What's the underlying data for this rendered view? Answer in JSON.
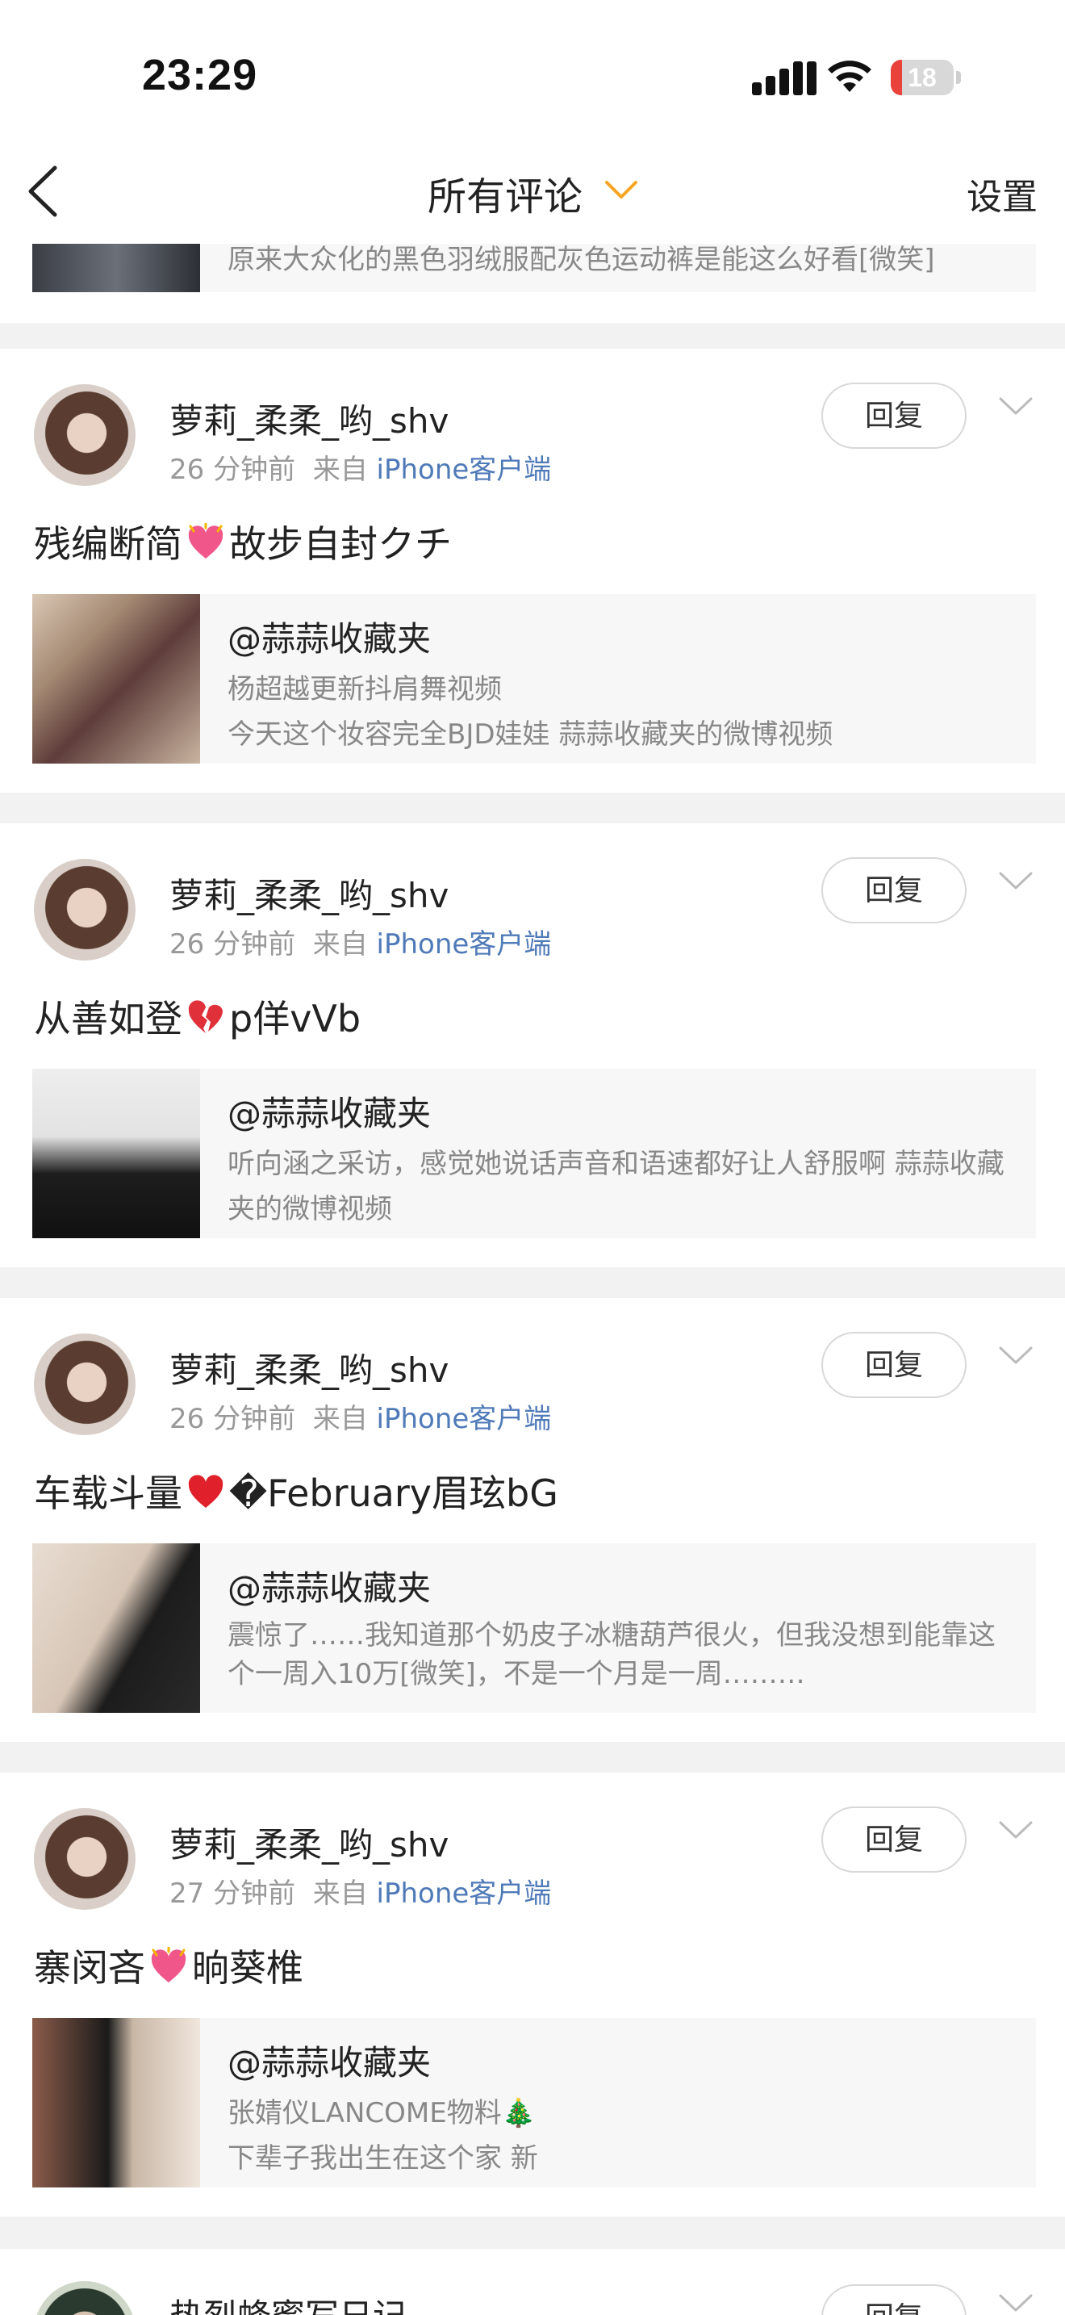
{
  "status": {
    "time": "23:29",
    "battery": "18",
    "battery_level": 0.18,
    "battery_color": "#e8423b"
  },
  "nav": {
    "title": "所有评论",
    "settings": "设置",
    "accent": "#f5a623"
  },
  "partial_top": {
    "text": "原来大众化的黑色羽绒服配灰色运动裤是能这么好看[微笑]"
  },
  "comments": [
    {
      "username": "萝莉_柔柔_哟_shv",
      "time": "26 分钟前",
      "from": "来自",
      "source": "iPhone客户端",
      "reply": "回复",
      "text_before": "残编断简",
      "emoji": "growing-heart",
      "text_after": "故步自封クチ",
      "quote_author": "@蒜蒜收藏夹",
      "quote_line1": "杨超越更新抖肩舞视频",
      "quote_line2": "今天这个妆容完全BJD娃娃 蒜蒜收藏夹的微博视频"
    },
    {
      "username": "萝莉_柔柔_哟_shv",
      "time": "26 分钟前",
      "from": "来自",
      "source": "iPhone客户端",
      "reply": "回复",
      "text_before": "从善如登",
      "emoji": "broken-heart",
      "text_after": "p佯vVb",
      "quote_author": "@蒜蒜收藏夹",
      "quote_line1": "听向涵之采访，感觉她说话声音和语速都好让人舒服啊 蒜蒜收藏夹的微博视频",
      "quote_line2": ""
    },
    {
      "username": "萝莉_柔柔_哟_shv",
      "time": "26 分钟前",
      "from": "来自",
      "source": "iPhone客户端",
      "reply": "回复",
      "text_before": "车载斗量",
      "emoji": "red-heart",
      "text_after": "�February眉玹bG",
      "quote_author": "@蒜蒜收藏夹",
      "quote_line1": "震惊了……我知道那个奶皮子冰糖葫芦很火，但我没想到能靠这个一周入10万[微笑]，不是一个月是一周………",
      "quote_line2": ""
    },
    {
      "username": "萝莉_柔柔_哟_shv",
      "time": "27 分钟前",
      "from": "来自",
      "source": "iPhone客户端",
      "reply": "回复",
      "text_before": "寨闵吝",
      "emoji": "growing-heart",
      "text_after": "晌葵椎",
      "quote_author": "@蒜蒜收藏夹",
      "quote_line1": "张婧仪LANCOME物料🎄",
      "quote_line2": "下辈子我出生在这个家 新"
    }
  ],
  "partial_bottom": {
    "username": "热烈蜂蜜写日记",
    "reply": "回复"
  }
}
